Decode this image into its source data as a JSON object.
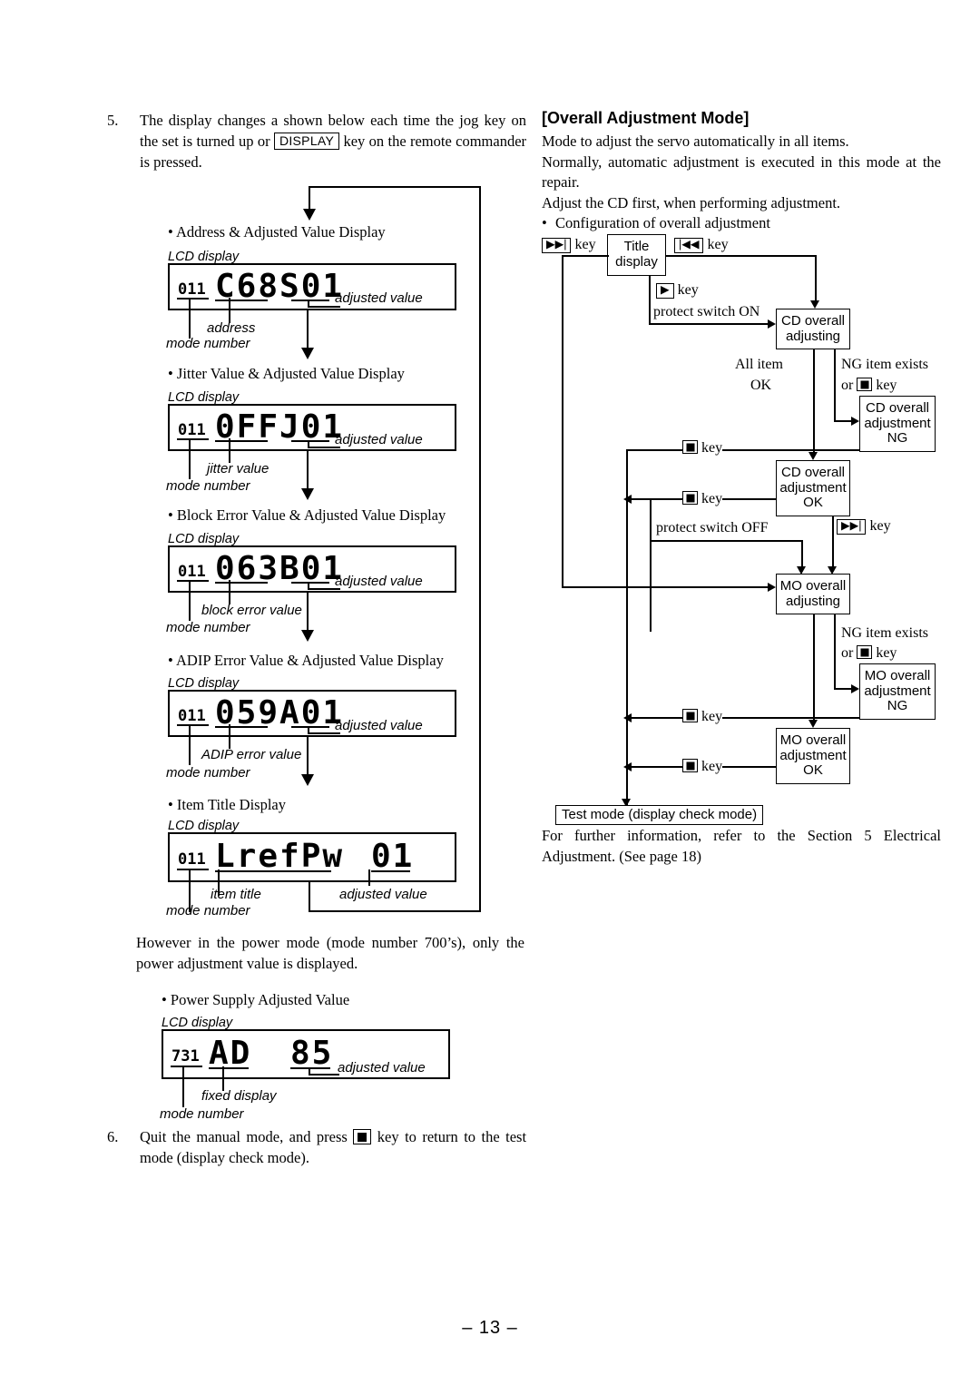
{
  "page_number": "– 13 –",
  "left_column": {
    "step5": {
      "number": "5.",
      "text_part1": "The display changes a shown below each time the jog key on the set is turned up or",
      "key_label": "DISPLAY",
      "text_part2": "key on the remote commander is pressed."
    },
    "lcd_caption": "LCD display",
    "displays": [
      {
        "bullet": "• Address & Adjusted Value Display",
        "mode": "011",
        "main": "C68S01",
        "anno_value": "adjusted value",
        "anno_mid": "address",
        "anno_mode": "mode number"
      },
      {
        "bullet": "• Jitter Value & Adjusted Value Display",
        "mode": "011",
        "main": "0FFJ01",
        "anno_value": "adjusted value",
        "anno_mid": "jitter value",
        "anno_mode": "mode number"
      },
      {
        "bullet": "• Block Error Value & Adjusted Value Display",
        "mode": "011",
        "main": "063B01",
        "anno_value": "adjusted value",
        "anno_mid": "block error value",
        "anno_mode": "mode number"
      },
      {
        "bullet": "• ADIP Error Value & Adjusted Value Display",
        "mode": "011",
        "main": "059A01",
        "anno_value": "adjusted value",
        "anno_mid": "ADIP error value",
        "anno_mode": "mode number"
      },
      {
        "bullet": "• Item Title Display",
        "mode": "011",
        "main": "LrefPw",
        "main2": "01",
        "anno_value": "adjusted value",
        "anno_mid": "item title",
        "anno_mode": "mode number"
      }
    ],
    "however_text": "However in the power mode (mode number 700’s), only the power adjustment value is displayed.",
    "power_display": {
      "bullet": "• Power Supply Adjusted Value",
      "caption": "LCD display",
      "mode": "731",
      "main": "AD",
      "main2": "85",
      "anno_value": "adjusted value",
      "anno_mid": "fixed display",
      "anno_mode": "mode number"
    },
    "step6": {
      "number": "6.",
      "text_part1": "Quit the manual mode, and press",
      "key_icon": "stop-key-icon",
      "text_part2": "key to return to the test mode (display check mode)."
    }
  },
  "right_column": {
    "heading": "[Overall Adjustment Mode]",
    "paragraphs": [
      "Mode to adjust the servo automatically in all items.",
      "Normally, automatic adjustment is executed in this mode at the repair.",
      "Adjust the CD first, when performing adjustment."
    ],
    "bullet": "Configuration of overall adjustment",
    "footer": "For further information, refer to the Section 5 Electrical Adjustment. (See page 18)",
    "flowchart": {
      "boxes": [
        {
          "id": "title-display",
          "lines": [
            "Title",
            "display"
          ]
        },
        {
          "id": "cd-overall-adjusting",
          "lines": [
            "CD overall",
            "adjusting"
          ]
        },
        {
          "id": "cd-overall-adjustment-ng",
          "lines": [
            "CD overall",
            "adjustment",
            "NG"
          ]
        },
        {
          "id": "cd-overall-adjustment-ok",
          "lines": [
            "CD overall",
            "adjustment",
            "OK"
          ]
        },
        {
          "id": "mo-overall-adjusting",
          "lines": [
            "MO overall",
            "adjusting"
          ]
        },
        {
          "id": "mo-overall-adjustment-ng",
          "lines": [
            "MO overall",
            "adjustment",
            "NG"
          ]
        },
        {
          "id": "mo-overall-adjustment-ok",
          "lines": [
            "MO overall",
            "adjustment",
            "OK"
          ]
        }
      ],
      "labels": {
        "next_key": "key",
        "prev_key": "key",
        "play_key": "key",
        "protect_on": "protect switch ON",
        "protect_off": "protect switch OFF",
        "all_item": "All item",
        "ok": "OK",
        "ng_item_exists": "NG item exists",
        "or": "or",
        "key_word": "key",
        "stop_key": "key"
      },
      "key_glyphs": {
        "next": "▶▶|",
        "prev": "|◀◀",
        "play": "▶",
        "stop": "stop-key-icon"
      },
      "test_mode": "Test mode (display check mode)"
    }
  }
}
